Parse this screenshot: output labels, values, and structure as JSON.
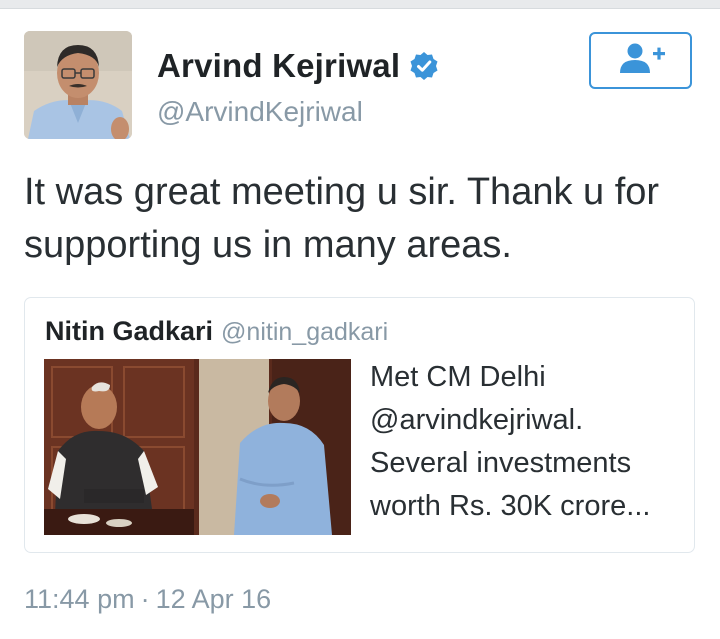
{
  "author": {
    "display_name": "Arvind Kejriwal",
    "handle": "@ArvindKejriwal",
    "verified_icon": "verified-badge-icon",
    "avatar_icon": "profile-photo"
  },
  "follow_button": {
    "icon": "follow-user-icon"
  },
  "tweet": {
    "text_line1": "It was great meeting u sir. Thank u for",
    "text_line2": "supporting us in many areas."
  },
  "quoted_tweet": {
    "display_name": "Nitin Gadkari",
    "handle": "@nitin_gadkari",
    "text_line1": "Met CM Delhi",
    "text_line2": "@arvindkejriwal.",
    "text_line3": "Several investments",
    "text_line4": "worth Rs. 30K crore..."
  },
  "meta": {
    "time": "11:44 pm",
    "separator": "·",
    "date": "12 Apr 16"
  },
  "colors": {
    "accent": "#3b94d9",
    "muted": "#8899a6",
    "text": "#292f33",
    "border": "#e1e8ed"
  }
}
